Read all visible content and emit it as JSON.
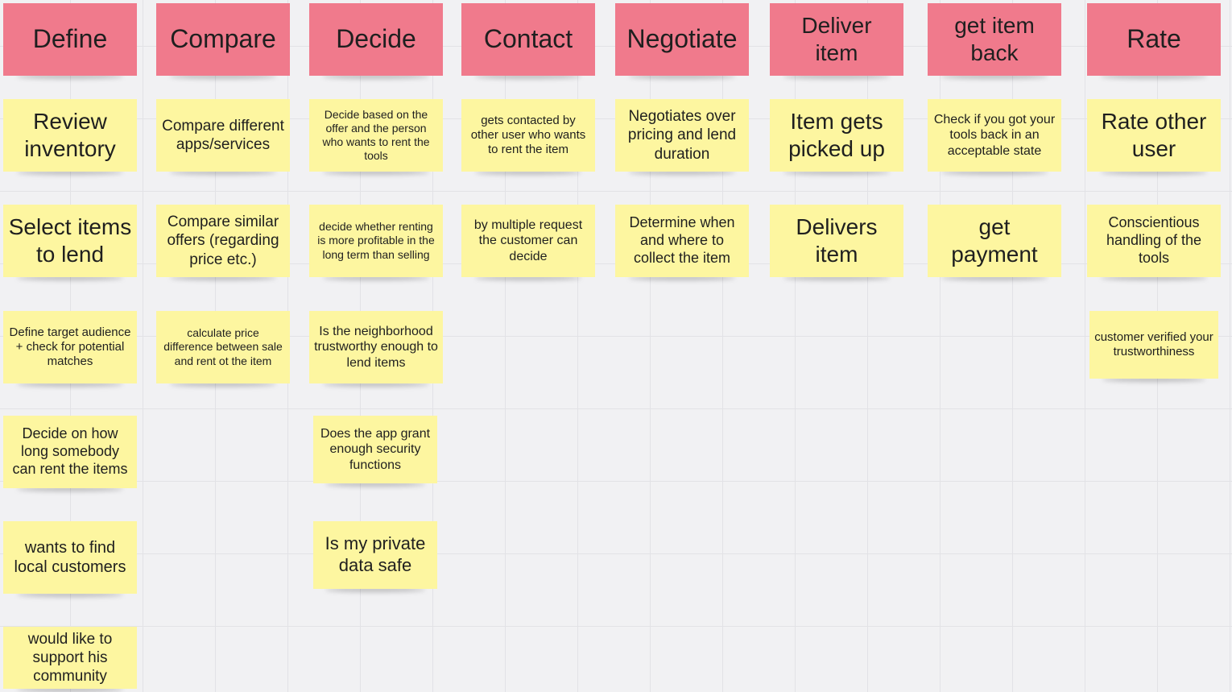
{
  "colors": {
    "header_note": "#f07a8c",
    "sticky_note": "#fdf6a0",
    "canvas": "#f1f1f3"
  },
  "columns": [
    {
      "header": "Define",
      "notes": [
        "Review inventory",
        "Select items to lend",
        "Define target audience + check for potential matches",
        "Decide on how long somebody can rent the items",
        "wants to find local customers",
        "would like to support his community"
      ]
    },
    {
      "header": "Compare",
      "notes": [
        "Compare different apps/services",
        "Compare similar offers (regarding price etc.)",
        "calculate price difference between sale and rent ot the item"
      ]
    },
    {
      "header": "Decide",
      "notes": [
        "Decide based on the offer and the person who wants to rent the tools",
        "decide whether renting is more profitable in the long term than selling",
        "Is the neighborhood trustworthy enough to lend items",
        "Does the app grant enough security functions",
        "Is my private data safe"
      ]
    },
    {
      "header": "Contact",
      "notes": [
        "gets contacted by other user who wants to rent the item",
        "by multiple request the customer can decide"
      ]
    },
    {
      "header": "Negotiate",
      "notes": [
        "Negotiates over pricing and lend duration",
        "Determine when and where to collect the item"
      ]
    },
    {
      "header": "Deliver\nitem",
      "notes": [
        "Item gets picked up",
        "Delivers item"
      ]
    },
    {
      "header": "get item\nback",
      "notes": [
        "Check if you got your tools back in an acceptable state",
        "get payment"
      ]
    },
    {
      "header": "Rate",
      "notes": [
        "Rate other user",
        "Conscientious handling of  the tools",
        "customer verified your trustworthiness"
      ]
    }
  ]
}
